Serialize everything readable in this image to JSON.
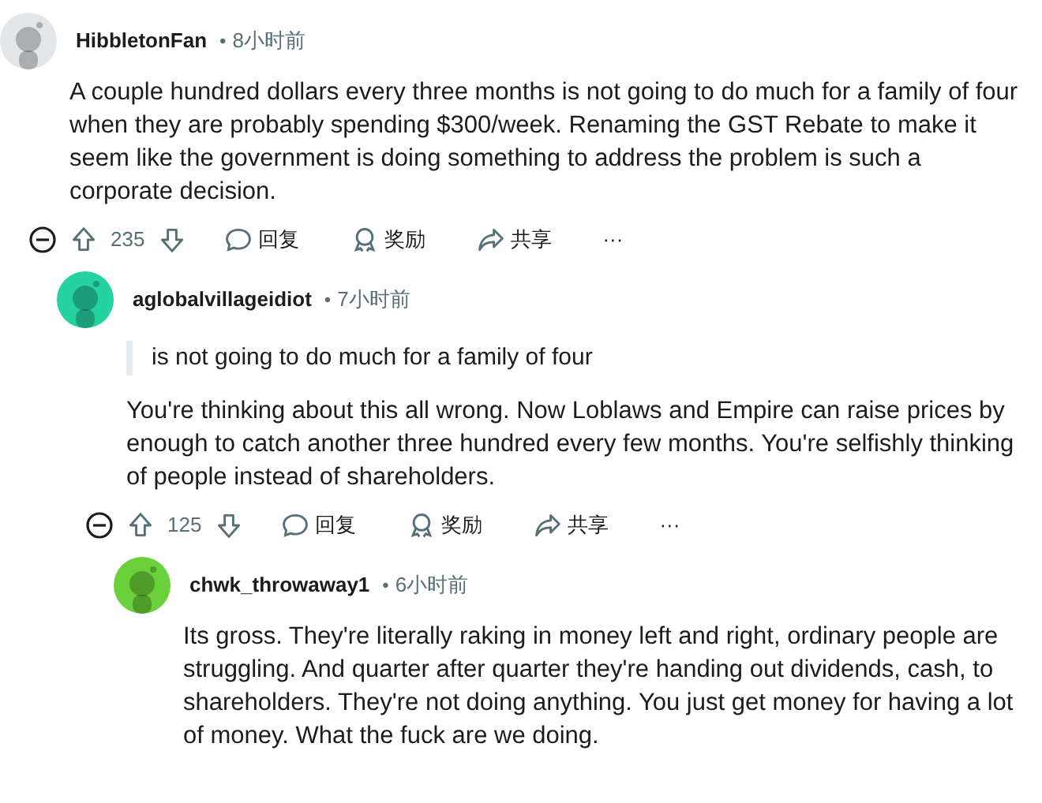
{
  "comments": [
    {
      "author": "HibbletonFan",
      "separator": "•",
      "time": "8小时前",
      "color": "#e4e7ea",
      "expanded": true,
      "body": [
        {
          "kind": "text",
          "text": "A couple hundred dollars every three months is not going to do much for a family of four when they are probably spending $300/week. Renaming the GST Rebate to make it seem like the government is doing something to address the problem is such a corporate decision."
        }
      ],
      "actions": {
        "score": "235",
        "reply": "回复",
        "award": "奖励",
        "share": "共享",
        "more": "···"
      },
      "children": [
        {
          "author": "aglobalvillageidiot",
          "separator": "•",
          "time": "7小时前",
          "color": "#24d3a0",
          "expanded": true,
          "body": [
            {
              "kind": "quote",
              "text": "is not going to do much for a family of four"
            },
            {
              "kind": "text",
              "text": "You're thinking about this all wrong. Now Loblaws and Empire can raise prices by enough to catch another three hundred every few months. You're selfishly thinking of people instead of shareholders."
            }
          ],
          "actions": {
            "score": "125",
            "reply": "回复",
            "award": "奖励",
            "share": "共享",
            "more": "···"
          },
          "children": [
            {
              "author": "chwk_throwaway1",
              "separator": "•",
              "time": "6小时前",
              "color": "#6bd13a",
              "body": [
                {
                  "kind": "text",
                  "text": "Its gross. They're literally raking in money left and right, ordinary people are struggling. And quarter after quarter they're handing out dividends, cash, to shareholders. They're not doing anything. You just get money for having a lot of money. What the fuck are we doing."
                }
              ]
            }
          ]
        }
      ]
    }
  ]
}
